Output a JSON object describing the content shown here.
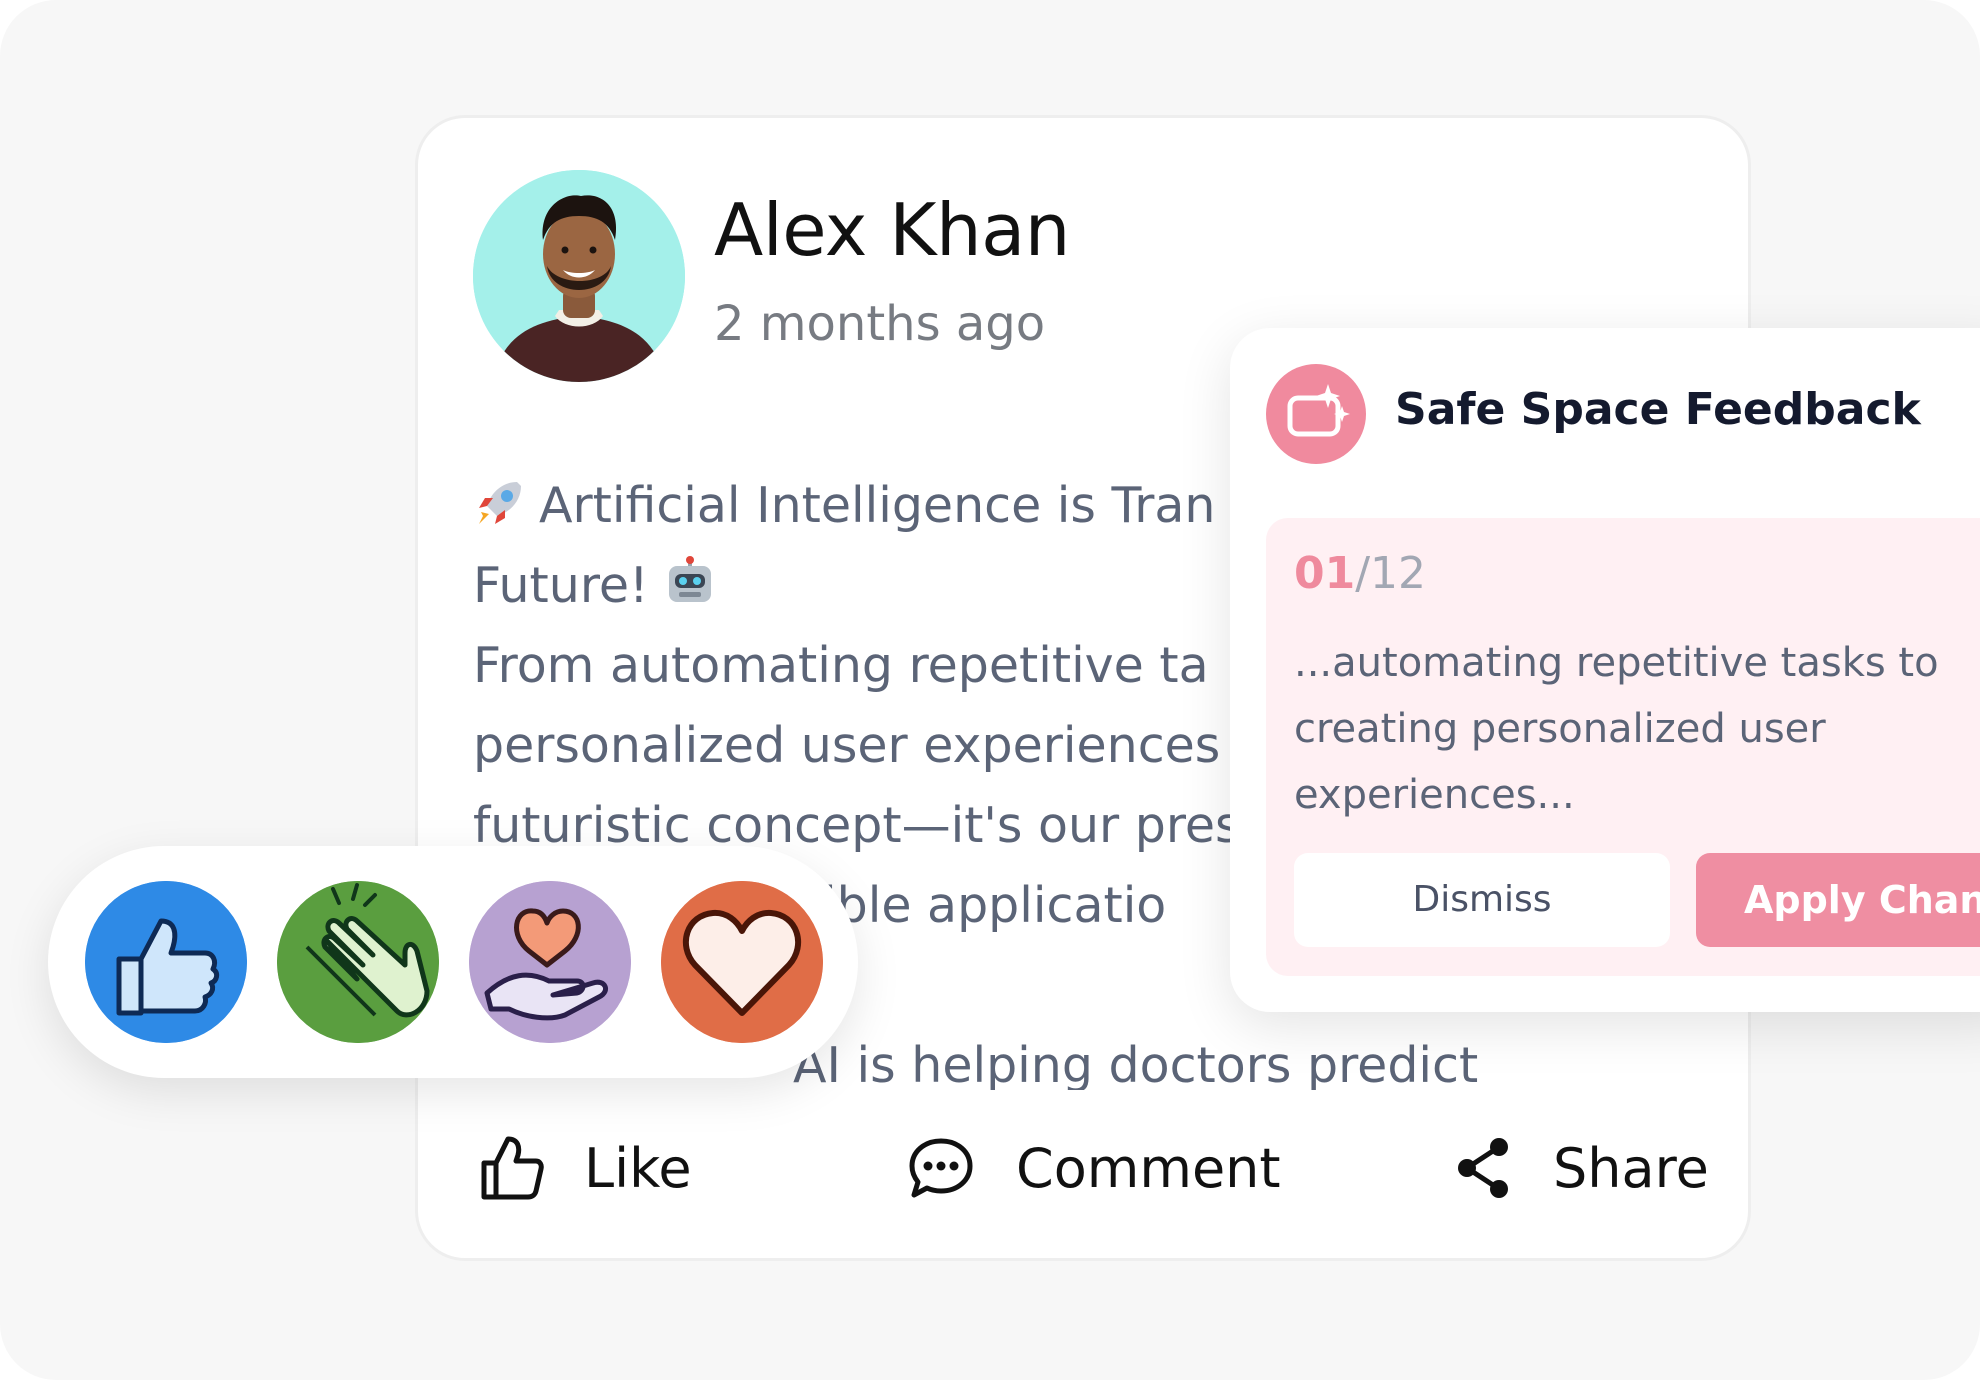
{
  "post": {
    "author": "Alex Khan",
    "time": "2 months ago",
    "body_lines": [
      "Artificial Intelligence is Tran",
      "Future!",
      "From automating repetitive ta",
      "personalized user experiences",
      "futuristic concept—it's our pres",
      "ible applicatio",
      "",
      "AI is helping doctors predict"
    ],
    "actions": {
      "like": "Like",
      "comment": "Comment",
      "share": "Share"
    }
  },
  "reactions": [
    {
      "icon": "thumbs-up-icon",
      "color": "#2e8ae6"
    },
    {
      "icon": "clapping-hands-icon",
      "color": "#5a9e3f"
    },
    {
      "icon": "heart-in-hand-icon",
      "color": "#b7a1d1"
    },
    {
      "icon": "heart-icon",
      "color": "#e06d47"
    }
  ],
  "feedback": {
    "title": "Safe Space Feedback",
    "counter_current": "01",
    "counter_total": "/12",
    "excerpt_lines": [
      "...automating repetitive tasks to",
      "creating personalized user",
      "experiences..."
    ],
    "dismiss_label": "Dismiss",
    "apply_label": "Apply Chang",
    "accent": "#ef8ea2"
  }
}
